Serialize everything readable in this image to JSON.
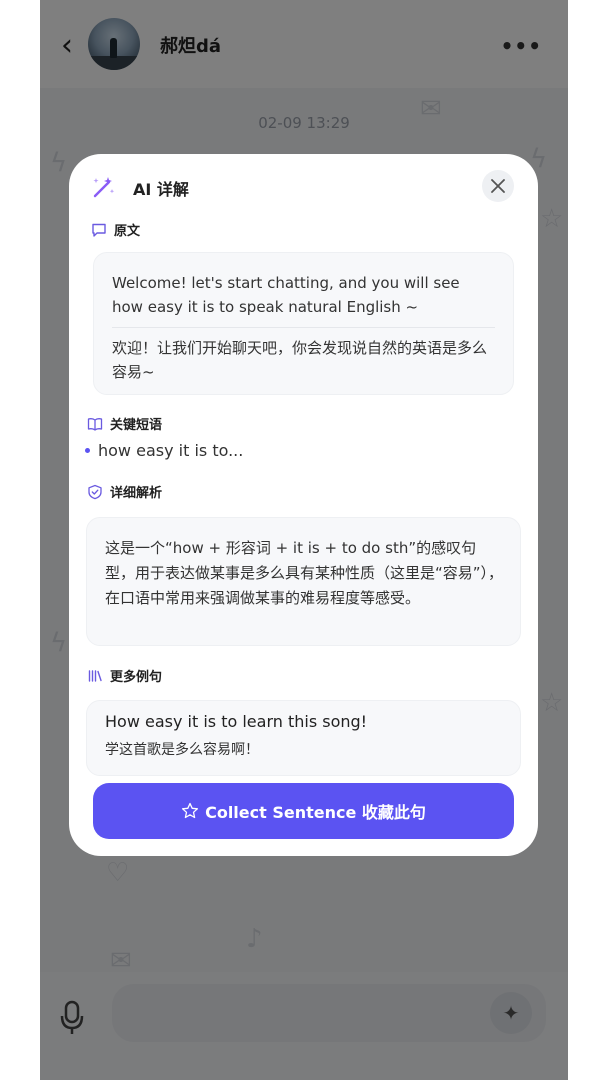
{
  "header": {
    "back_glyph": "‹",
    "contact_name": "郝炟dá",
    "more_glyph": "•••"
  },
  "chat": {
    "timestamp": "02-09 13:29"
  },
  "input_bar": {
    "spark_glyph": "✦"
  },
  "modal": {
    "title": "AI 详解",
    "close_glyph": "✕",
    "original": {
      "heading": "原文",
      "english": "Welcome! let's start chatting, and you will see how easy it is to speak natural English ~",
      "chinese": "欢迎！让我们开始聊天吧，你会发现说自然的英语是多么容易~"
    },
    "key_phrases": {
      "heading": "关键短语",
      "items": [
        "how easy it is to..."
      ]
    },
    "detail": {
      "heading": "详细解析",
      "text": "这是一个“how + 形容词 + it is + to do sth”的感叹句型，用于表达做某事是多么具有某种性质（这里是“容易”），在口语中常用来强调做某事的难易程度等感受。"
    },
    "examples": {
      "heading": "更多例句",
      "items": [
        {
          "en": "How easy it is to learn this song!",
          "cn": "学这首歌是多么容易啊！"
        }
      ]
    },
    "collect_label": "Collect Sentence 收藏此句",
    "collect_icon": "star-outline-icon"
  },
  "colors": {
    "accent": "#5b53f2",
    "icon_purple": "#6a5ae0",
    "overlay": "rgba(0,0,0,0.5)"
  }
}
